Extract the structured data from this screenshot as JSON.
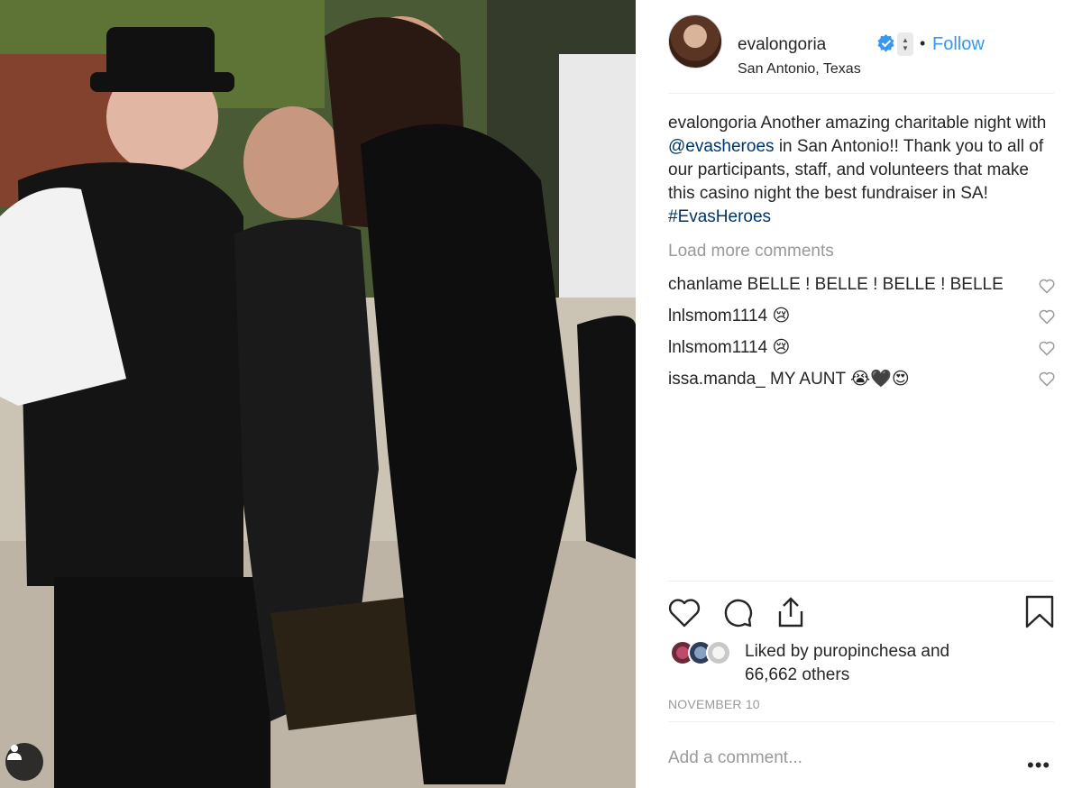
{
  "post": {
    "username": "evalongoria",
    "location": "San Antonio, Texas",
    "follow_label": "Follow",
    "dot": "•",
    "verified_icon": "verified-badge-icon",
    "caption": {
      "username": "evalongoria",
      "text_1": "Another amazing charitable night with",
      "mention": "@evasheroes",
      "text_2": "in San Antonio!! Thank you to all of our participants, staff, and volunteers that make this casino night the best fundraiser in SA!",
      "hashtag": "#EvasHeroes"
    },
    "load_more": "Load more comments",
    "comments": [
      {
        "user": "chanlame",
        "text": "BELLE ! BELLE ! BELLE ! BELLE"
      },
      {
        "user": "lnlsmom1114",
        "text": "😢"
      },
      {
        "user": "lnlsmom1114",
        "text": "😢"
      },
      {
        "user": "issa.manda_",
        "text": "MY AUNT 😭🖤😍"
      }
    ],
    "likes": {
      "line1": "Liked by puropinchesa and",
      "line2": "66,662 others"
    },
    "date": "NOVEMBER 10",
    "add_comment_placeholder": "Add a comment...",
    "more_label": "•••"
  },
  "colors": {
    "link": "#003569",
    "follow": "#3897f0",
    "muted": "#999999",
    "text": "#262626"
  }
}
